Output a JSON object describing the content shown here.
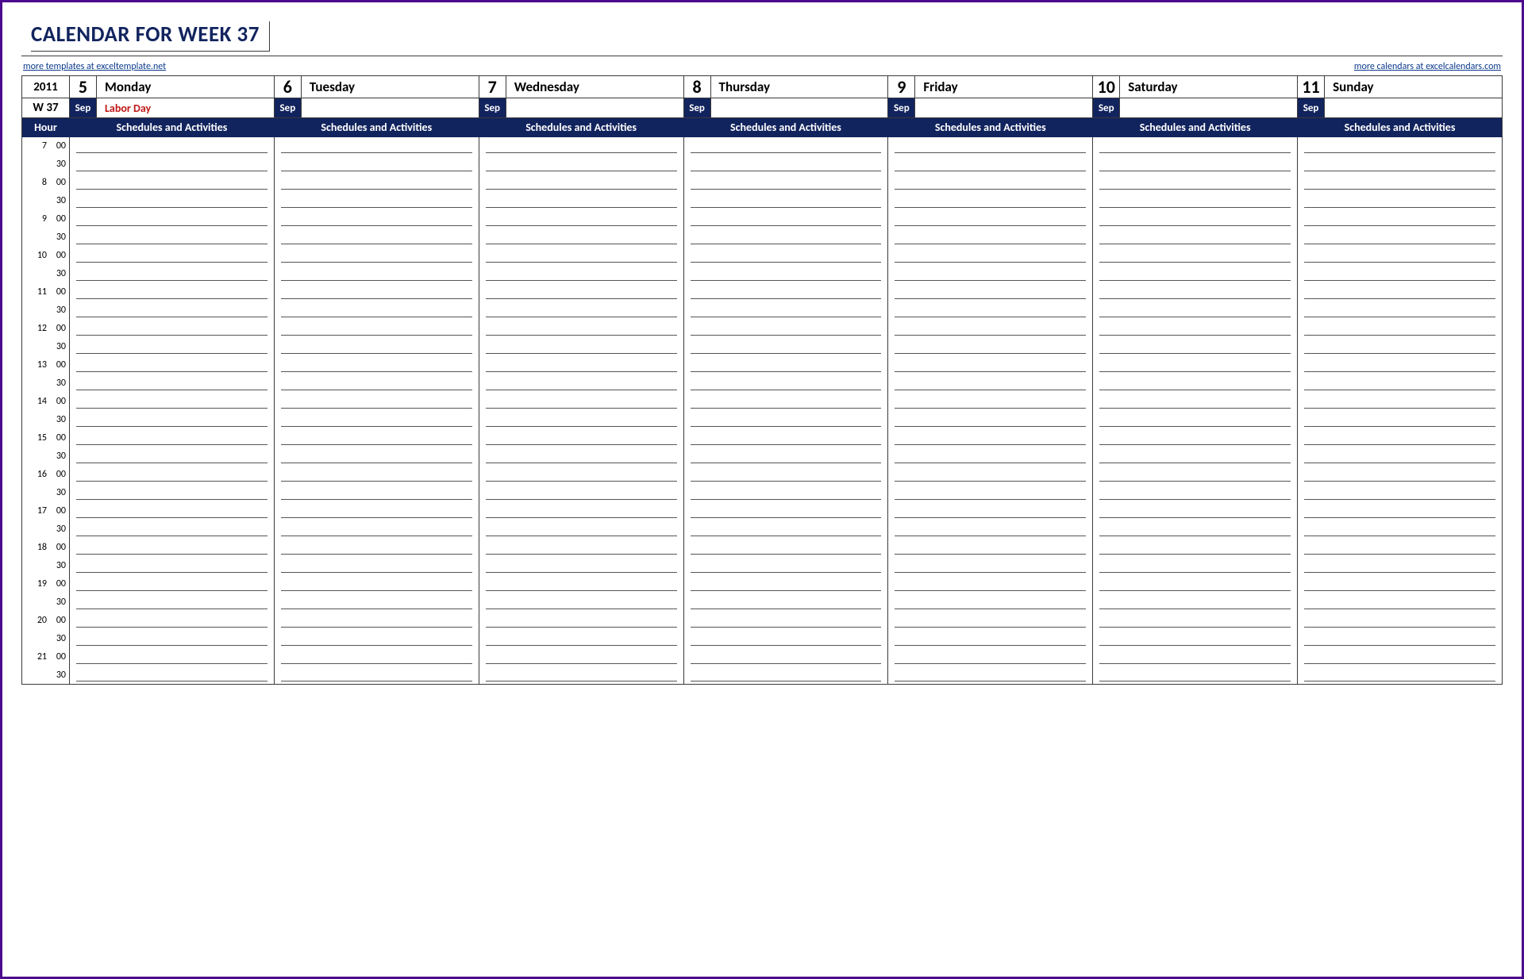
{
  "title": "CALENDAR FOR WEEK 37",
  "link_left": "more templates at exceltemplate.net",
  "link_right": "more calendars at excelcalendars.com",
  "year": "2011",
  "week_label": "W 37",
  "hour_header": "Hour",
  "activity_header": "Schedules and Activities",
  "month_abbrev": "Sep",
  "days": [
    {
      "num": "5",
      "name": "Monday",
      "note": "Labor Day"
    },
    {
      "num": "6",
      "name": "Tuesday",
      "note": ""
    },
    {
      "num": "7",
      "name": "Wednesday",
      "note": ""
    },
    {
      "num": "8",
      "name": "Thursday",
      "note": ""
    },
    {
      "num": "9",
      "name": "Friday",
      "note": ""
    },
    {
      "num": "10",
      "name": "Saturday",
      "note": ""
    },
    {
      "num": "11",
      "name": "Sunday",
      "note": ""
    }
  ],
  "hours": [
    7,
    8,
    9,
    10,
    11,
    12,
    13,
    14,
    15,
    16,
    17,
    18,
    19,
    20,
    21
  ],
  "minutes": [
    "00",
    "30"
  ]
}
